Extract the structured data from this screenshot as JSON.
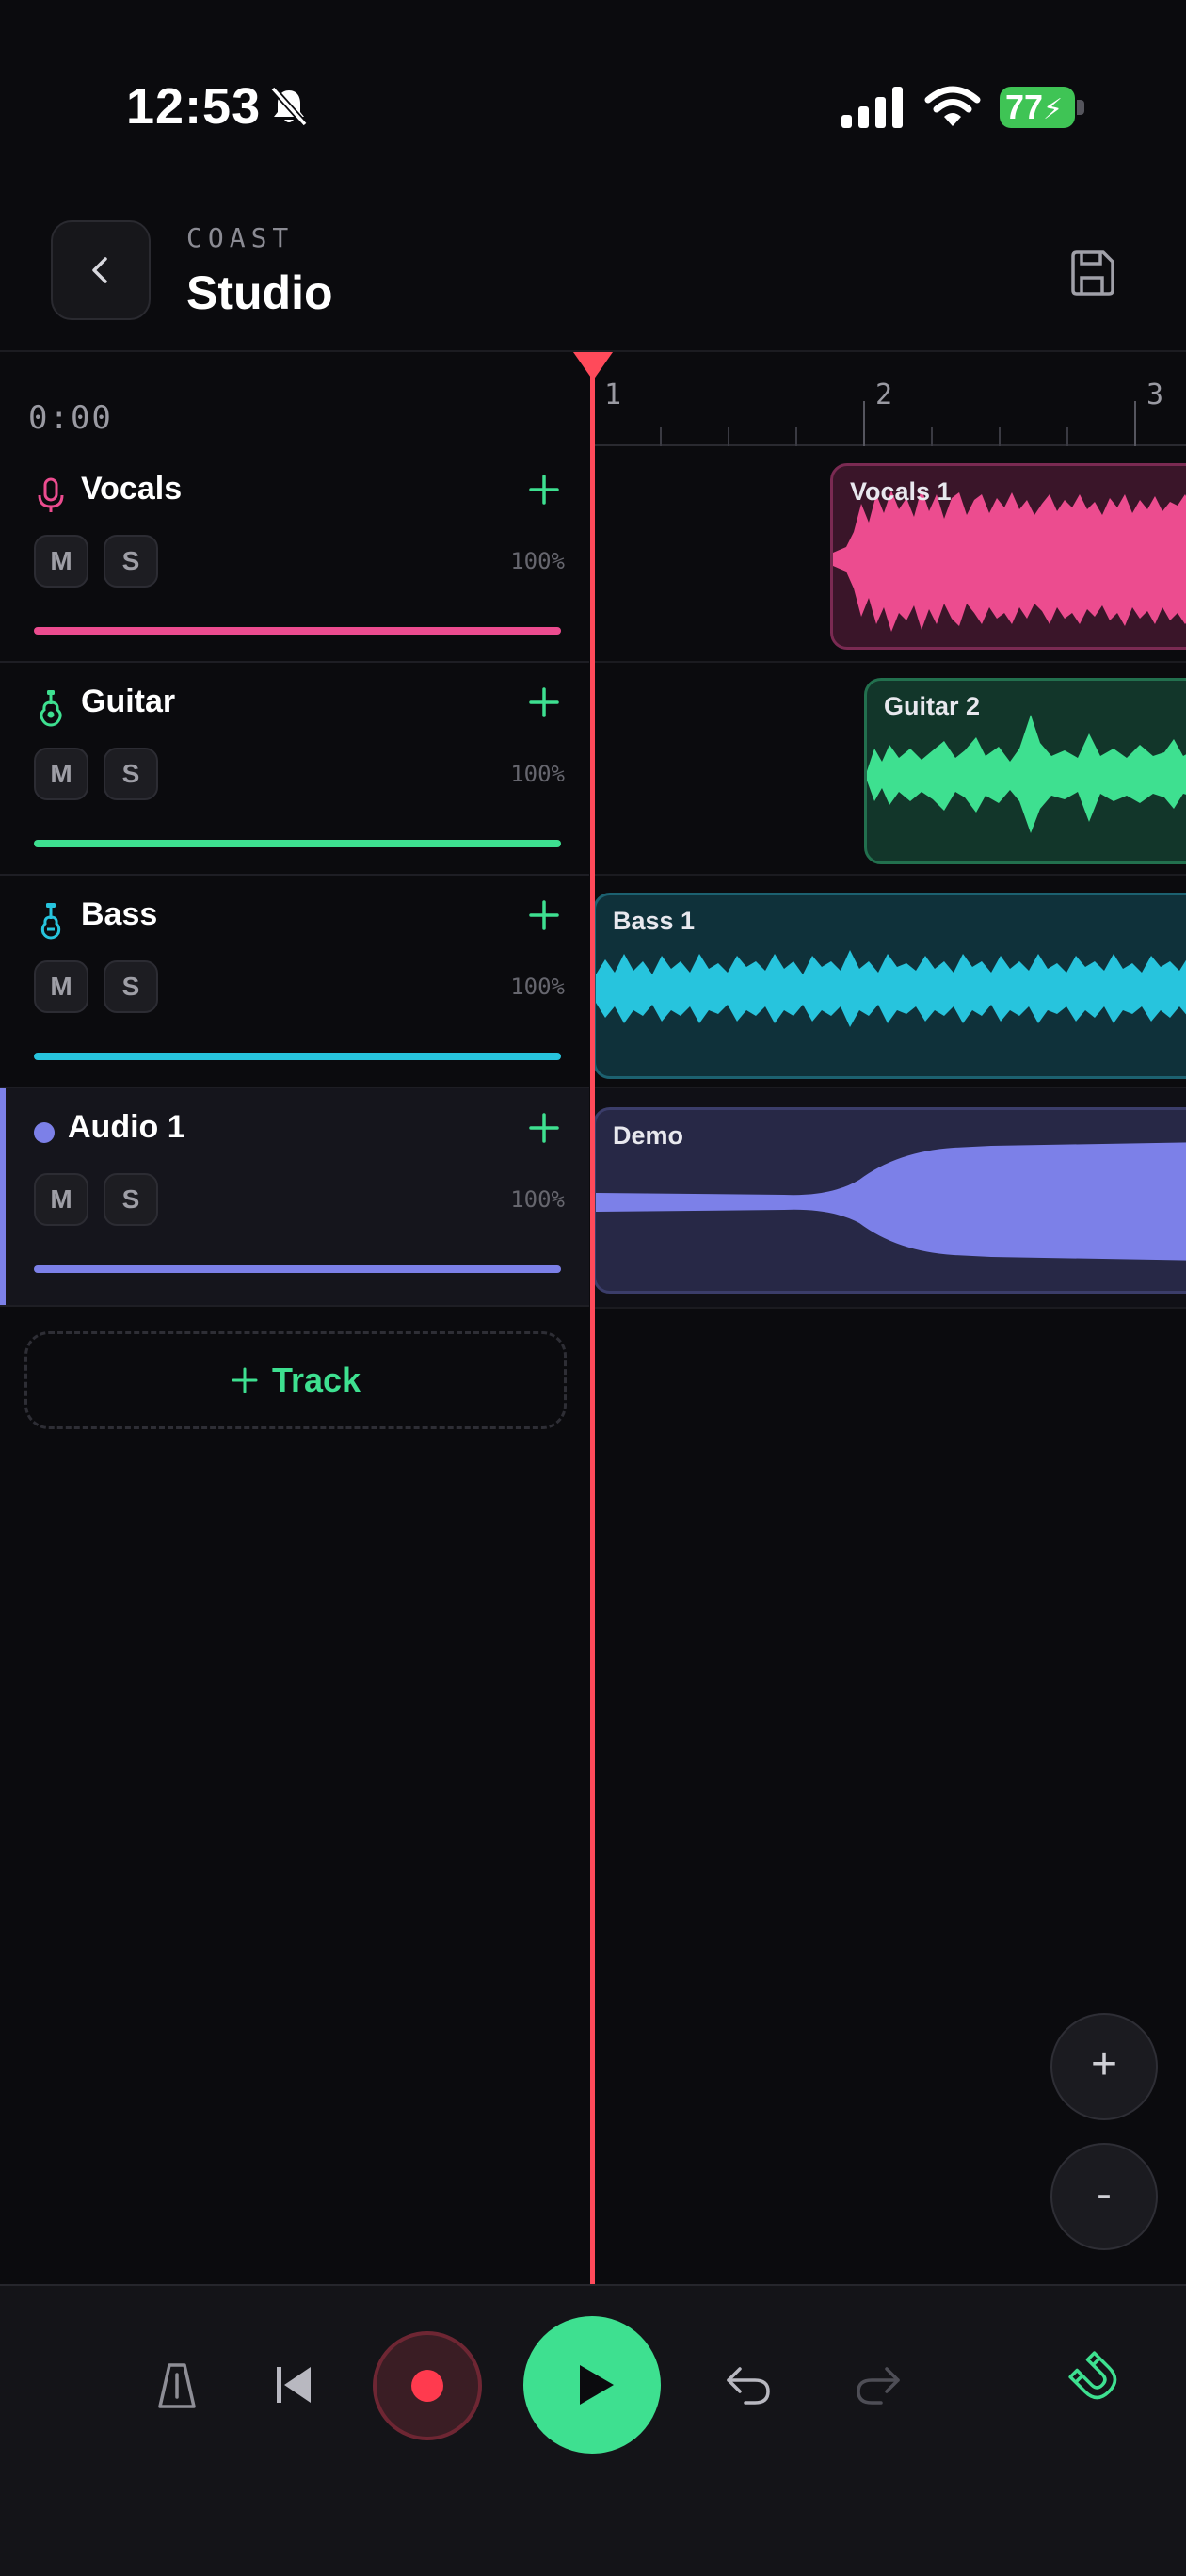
{
  "status_bar": {
    "time": "12:53",
    "battery": "77"
  },
  "header": {
    "brand": "COAST",
    "title": "Studio"
  },
  "transport": {
    "time": "0:00"
  },
  "ruler": {
    "marks": [
      "1",
      "2",
      "3"
    ]
  },
  "tracks": [
    {
      "name": "Vocals",
      "icon": "microphone-icon",
      "color": "#ec4c8f",
      "mute": "M",
      "solo": "S",
      "volume": "100%"
    },
    {
      "name": "Guitar",
      "icon": "guitar-icon",
      "color": "#3ee090",
      "mute": "M",
      "solo": "S",
      "volume": "100%"
    },
    {
      "name": "Bass",
      "icon": "bass-icon",
      "color": "#27c4dd",
      "mute": "M",
      "solo": "S",
      "volume": "100%"
    },
    {
      "name": "Audio 1",
      "icon": "dot-icon",
      "color": "#7c80e8",
      "mute": "M",
      "solo": "S",
      "volume": "100%",
      "selected": true
    }
  ],
  "clips": [
    {
      "label": "Vocals 1",
      "track": "Vocals"
    },
    {
      "label": "Guitar 2",
      "track": "Guitar"
    },
    {
      "label": "Bass 1",
      "track": "Bass"
    },
    {
      "label": "Demo",
      "track": "Audio 1"
    }
  ],
  "add_track": {
    "label": "Track"
  },
  "zoom": {
    "in": "+",
    "out": "-"
  }
}
